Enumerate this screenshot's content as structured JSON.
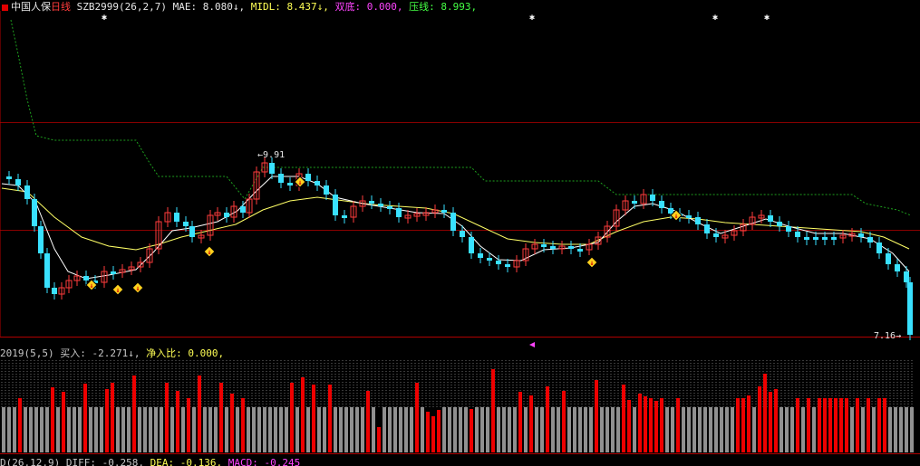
{
  "header": {
    "stock_name": "中国人保",
    "period": "日线",
    "indicator": "SZB2999(26,2,7)",
    "mae_label": "MAE:",
    "mae_value": "8.080",
    "midl_label": "MIDL:",
    "midl_value": "8.437",
    "double_bottom_label": "双底:",
    "double_bottom_value": "0.000,",
    "pressure_label": "压线:",
    "pressure_value": "8.993,",
    "down_arrow": "↓"
  },
  "main_chart": {
    "high_label": "9.91",
    "low_label": "7.16",
    "colors": {
      "up": "#ff3c3c",
      "down": "#39e1ff",
      "ma_short": "#ffffff",
      "ma_long": "#ffff66",
      "pressure": "#1ea01e",
      "grid": "#8a0000"
    }
  },
  "sub_panel": {
    "indicator": "2019(5,5)",
    "buy_label": "买入:",
    "buy_value": "-2.271",
    "net_label": "净入比:",
    "net_value": "0.000,",
    "down_arrow": "↓"
  },
  "macd_bar": {
    "indicator": "D(26,12,9)",
    "diff_label": "DIFF:",
    "diff_value": "-0.258",
    "dea_label": "DEA:",
    "dea_value": "-0.136",
    "macd_label": "MACD:",
    "macd_value": "-0.245"
  }
}
